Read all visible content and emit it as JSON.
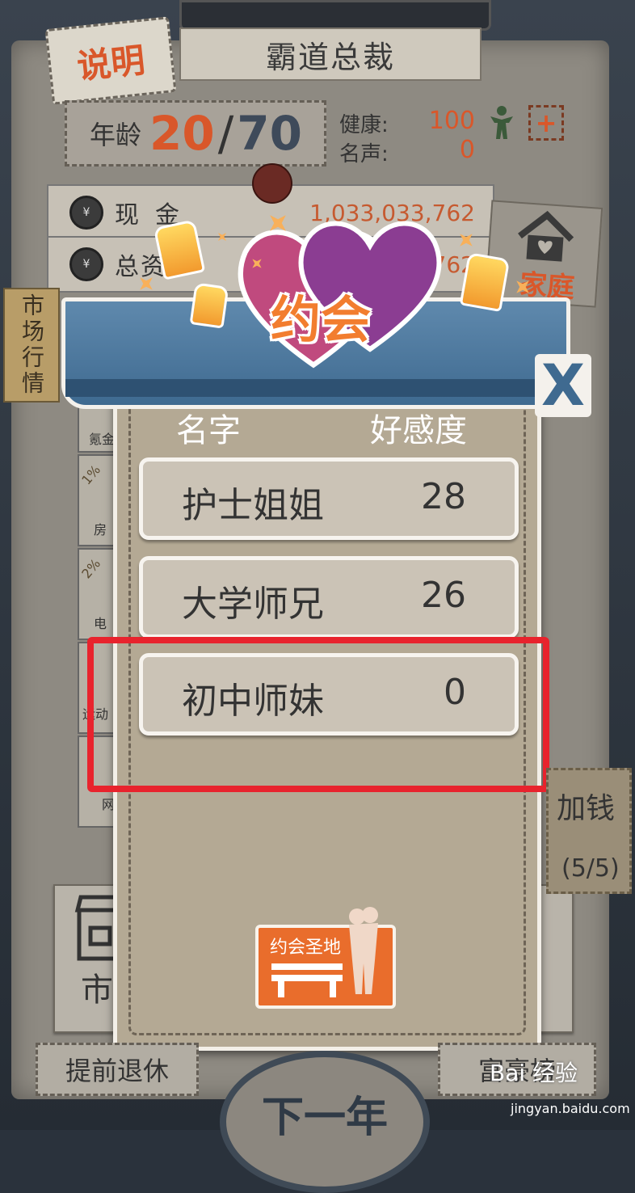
{
  "header": {
    "title": "霸道总裁",
    "explain_label": "说明"
  },
  "age": {
    "label": "年龄",
    "current": "20",
    "separator": "/",
    "max": "70"
  },
  "stats": {
    "health_label": "健康:",
    "health_value": "100",
    "fame_label": "名声:",
    "fame_value": "0",
    "add_label": "+"
  },
  "money": {
    "cash_label": "现金",
    "cash_value": "1,033,033,762",
    "assets_label": "总资",
    "assets_value": "762"
  },
  "family_label": "家庭",
  "market_label": "市场行情",
  "side_items": [
    {
      "label": "氪金"
    },
    {
      "label": "房",
      "badge": "1%"
    },
    {
      "label": "电",
      "badge": "2%"
    },
    {
      "label": "运动"
    },
    {
      "label": "网"
    }
  ],
  "dialog": {
    "title": "约会",
    "close_label": "X",
    "col_name": "名字",
    "col_affinity": "好感度",
    "rows": [
      {
        "name": "护士姐姐",
        "value": "28"
      },
      {
        "name": "大学师兄",
        "value": "26"
      },
      {
        "name": "初中师妹",
        "value": "0"
      }
    ],
    "spot_label": "约会圣地"
  },
  "ticket": {
    "label": "加钱",
    "count": "(5/5)"
  },
  "bottom": {
    "retire_label": "提前退休",
    "rich_label": "富豪榜",
    "next_year_label": "下一年",
    "market_short": "市"
  },
  "watermark": {
    "text": "Bai 经验",
    "url": "jingyan.baidu.com"
  },
  "colors": {
    "accent": "#d9572a",
    "highlight": "#e8232d",
    "banner": "#4f7aa0"
  }
}
